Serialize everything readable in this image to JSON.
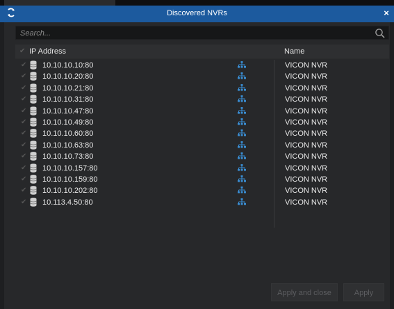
{
  "window": {
    "title": "Discovered NVRs",
    "refresh_icon": "refresh-icon",
    "close_label": "×",
    "accent": "#1c5a9e"
  },
  "search": {
    "placeholder": "Search...",
    "value": ""
  },
  "table": {
    "headers": {
      "ip": "IP Address",
      "name": "Name"
    },
    "rows": [
      {
        "ip": "10.10.10.10:80",
        "name": "VICON NVR"
      },
      {
        "ip": "10.10.10.20:80",
        "name": "VICON NVR"
      },
      {
        "ip": "10.10.10.21:80",
        "name": "VICON NVR"
      },
      {
        "ip": "10.10.10.31:80",
        "name": "VICON NVR"
      },
      {
        "ip": "10.10.10.47:80",
        "name": "VICON NVR"
      },
      {
        "ip": "10.10.10.49:80",
        "name": "VICON NVR"
      },
      {
        "ip": "10.10.10.60:80",
        "name": "VICON NVR"
      },
      {
        "ip": "10.10.10.63:80",
        "name": "VICON NVR"
      },
      {
        "ip": "10.10.10.73:80",
        "name": "VICON NVR"
      },
      {
        "ip": "10.10.10.157:80",
        "name": "VICON NVR"
      },
      {
        "ip": "10.10.10.159:80",
        "name": "VICON NVR"
      },
      {
        "ip": "10.10.10.202:80",
        "name": "VICON NVR"
      },
      {
        "ip": "10.113.4.50:80",
        "name": "VICON NVR"
      }
    ]
  },
  "buttons": {
    "apply_close": "Apply and close",
    "apply": "Apply"
  }
}
